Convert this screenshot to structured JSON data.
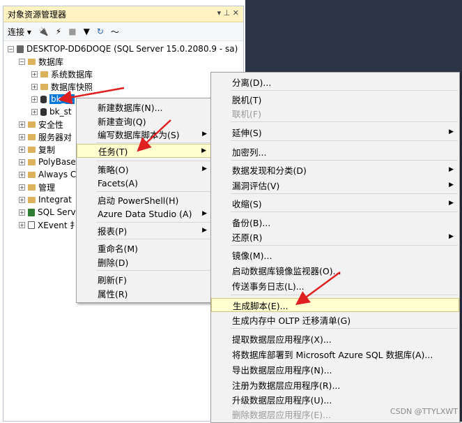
{
  "panel": {
    "title": "对象资源管理器",
    "pin_glyphs": "▾ ⊥ ✕",
    "toolbar": {
      "connect_label": "连接 ▾"
    }
  },
  "tree": {
    "server": "DESKTOP-DD6DOQE (SQL Server 15.0.2080.9 - sa)",
    "databases": "数据库",
    "system_db": "系统数据库",
    "snapshots": "数据库快照",
    "db1": "bk_st",
    "db2": "bk_st",
    "security": "安全性",
    "server_objects": "服务器对",
    "replication": "复制",
    "polybase": "PolyBase",
    "always_on": "Always C",
    "management": "管理",
    "integration": "Integrat",
    "sql_agent": "SQL Serv",
    "xevent": "XEvent 扌"
  },
  "context_menu": {
    "items": [
      "新建数据库(N)...",
      "新建查询(Q)",
      "编写数据库脚本为(S)",
      "任务(T)",
      "策略(O)",
      "Facets(A)",
      "启动 PowerShell(H)",
      "Azure Data Studio (A)",
      "报表(P)",
      "重命名(M)",
      "删除(D)",
      "刷新(F)",
      "属性(R)"
    ]
  },
  "tasks_menu": {
    "items": [
      "分离(D)...",
      "脱机(T)",
      "联机(F)",
      "延伸(S)",
      "加密列...",
      "数据发现和分类(D)",
      "漏洞评估(V)",
      "收缩(S)",
      "备份(B)...",
      "还原(R)",
      "镜像(M)...",
      "启动数据库镜像监视器(O)...",
      "传送事务日志(L)...",
      "生成脚本(E)...",
      "生成内存中 OLTP 迁移清单(G)",
      "提取数据层应用程序(X)...",
      "将数据库部署到 Microsoft Azure SQL 数据库(A)...",
      "导出数据层应用程序(N)...",
      "注册为数据层应用程序(R)...",
      "升级数据层应用程序(U)...",
      "删除数据层应用程序(E)..."
    ]
  },
  "watermark": "CSDN @TTYLXWT",
  "colors": {
    "title_bg": "#fff3c4",
    "selection": "#0078d7",
    "highlight": "#ffffd0",
    "arrow": "#e02020"
  }
}
